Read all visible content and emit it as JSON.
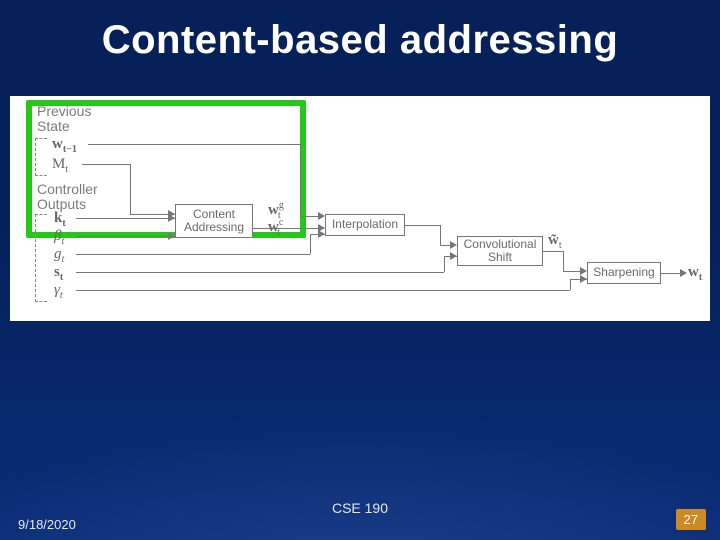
{
  "slide": {
    "title": "Content-based addressing",
    "course": "CSE 190",
    "date": "9/18/2020",
    "page_number": "27"
  },
  "figure": {
    "group_labels": {
      "previous_state": "Previous\nState",
      "controller_outputs": "Controller\nOutputs"
    },
    "symbols": {
      "w_prev": "w",
      "w_prev_sub": "t−1",
      "M": "M",
      "M_sub": "t",
      "k": "k",
      "k_sub": "t",
      "beta": "β",
      "beta_sub": "t",
      "g": "g",
      "g_sub": "t",
      "s": "s",
      "s_sub": "t",
      "gamma": "γ",
      "gamma_sub": "t",
      "wc": "w",
      "wc_sub": "t",
      "wc_sup": "c",
      "wg": "w",
      "wg_sub": "t",
      "wg_sup": "g",
      "wtilde": "w̃",
      "wtilde_sub": "t",
      "wout": "w",
      "wout_sub": "t"
    },
    "nodes": {
      "content_addressing": "Content\nAddressing",
      "interpolation": "Interpolation",
      "conv_shift": "Convolutional\nShift",
      "sharpening": "Sharpening"
    },
    "highlight_box": "content-addressing-stage"
  }
}
